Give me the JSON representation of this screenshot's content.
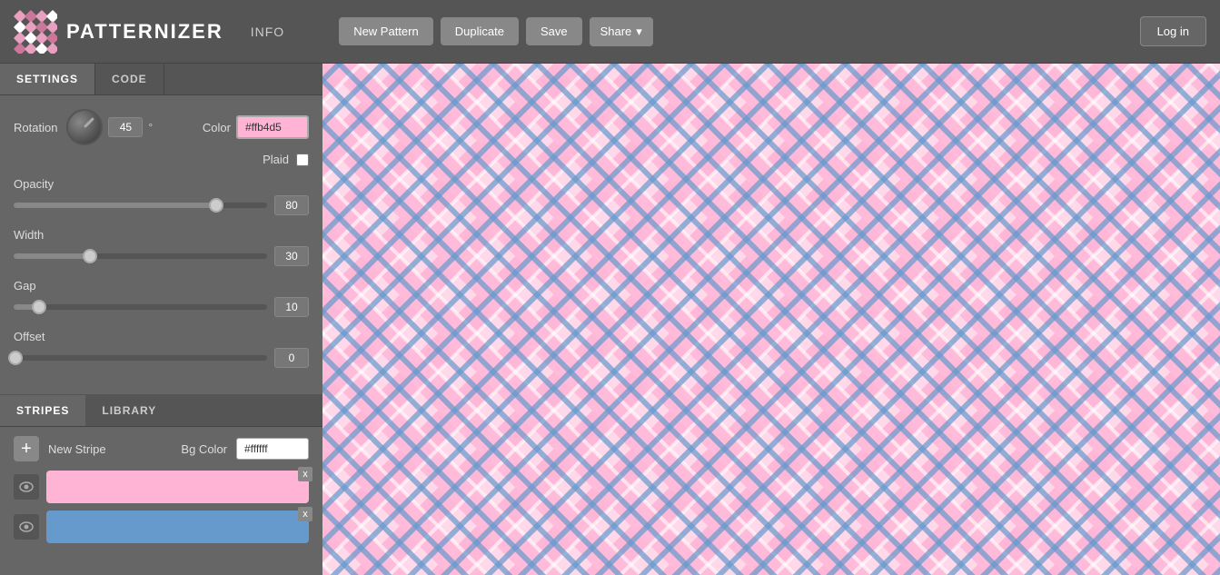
{
  "header": {
    "logo_text": "PATTERNIZER",
    "info_label": "INFO",
    "new_pattern_label": "New Pattern",
    "duplicate_label": "Duplicate",
    "save_label": "Save",
    "share_label": "Share",
    "share_arrow": "▾",
    "login_label": "Log in"
  },
  "sidebar": {
    "settings_tab": "SETTINGS",
    "code_tab": "CODE",
    "rotation_label": "Rotation",
    "rotation_value": "45",
    "rotation_deg": "°",
    "color_label": "Color",
    "color_value": "#ffb4d5",
    "plaid_label": "Plaid",
    "opacity_label": "Opacity",
    "opacity_value": "80",
    "opacity_percent": 80,
    "width_label": "Width",
    "width_value": "30",
    "width_percent": 30,
    "gap_label": "Gap",
    "gap_value": "10",
    "gap_percent": 10,
    "offset_label": "Offset",
    "offset_value": "0",
    "offset_percent": 0,
    "stripes_tab": "STRIPES",
    "library_tab": "LIBRARY",
    "add_stripe_label": "+",
    "new_stripe_label": "New Stripe",
    "bg_color_label": "Bg Color",
    "bg_color_value": "#ffffff",
    "stripe1_color": "#ffb4d5",
    "stripe2_color": "#6699cc"
  },
  "canvas": {
    "bg_color": "#f5c0d8"
  }
}
